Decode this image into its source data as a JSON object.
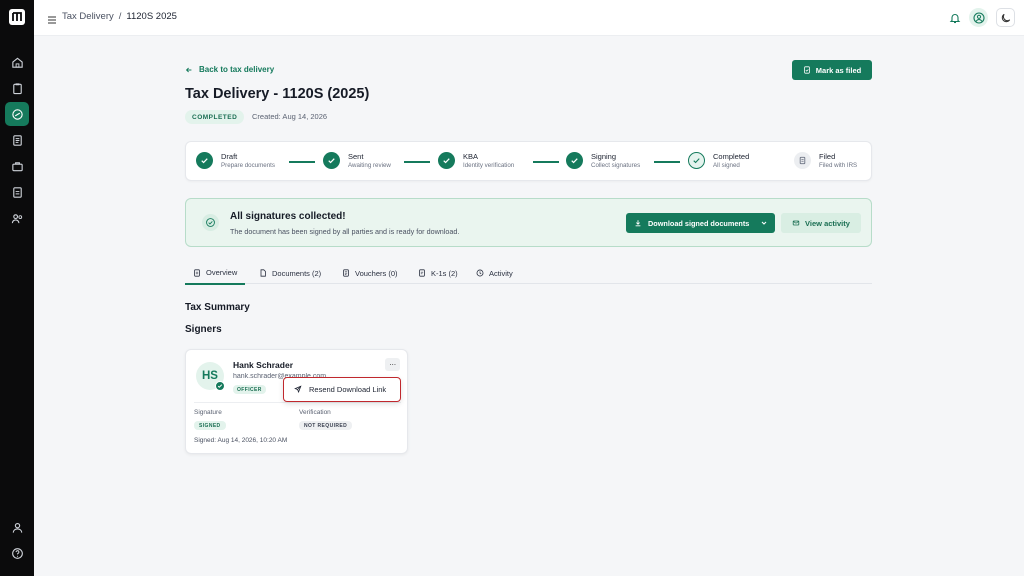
{
  "header": {
    "breadcrumb": [
      "Tax Delivery",
      "1120S 2025"
    ],
    "breadcrumb_sep": "/"
  },
  "page": {
    "back_link": "Back to tax delivery",
    "mark_filed_button": "Mark as filed",
    "title": "Tax Delivery - 1120S (2025)",
    "status_badge": "COMPLETED",
    "created": "Created: Aug 14, 2026"
  },
  "stepper": {
    "steps": [
      {
        "label": "Draft",
        "sub": "Prepare documents",
        "state": "done"
      },
      {
        "label": "Sent",
        "sub": "Awaiting review",
        "state": "done"
      },
      {
        "label": "KBA",
        "sub": "Identity verification",
        "state": "done"
      },
      {
        "label": "Signing",
        "sub": "Collect signatures",
        "state": "done"
      },
      {
        "label": "Completed",
        "sub": "All signed",
        "state": "current"
      },
      {
        "label": "Filed",
        "sub": "Filed with IRS",
        "state": "pending"
      }
    ]
  },
  "banner": {
    "title": "All signatures collected!",
    "subtitle": "The document has been signed by all parties and is ready for download.",
    "download_button": "Download signed documents",
    "activity_button": "View activity"
  },
  "tabs": [
    {
      "label": "Overview",
      "icon": "document-icon",
      "active": true
    },
    {
      "label": "Documents (2)",
      "icon": "file-icon",
      "active": false
    },
    {
      "label": "Vouchers (0)",
      "icon": "receipt-icon",
      "active": false
    },
    {
      "label": "K-1s (2)",
      "icon": "form-icon",
      "active": false
    },
    {
      "label": "Activity",
      "icon": "clock-icon",
      "active": false
    }
  ],
  "sections": {
    "tax_summary": "Tax Summary",
    "signers": "Signers"
  },
  "signer": {
    "initials": "HS",
    "name": "Hank Schrader",
    "email": "hank.schrader@example.com",
    "role": "OFFICER",
    "more": "···",
    "signature_label": "Signature",
    "signature_status": "SIGNED",
    "verification_label": "Verification",
    "verification_status": "NOT REQUIRED",
    "signed_at": "Signed: Aug 14, 2026, 10:20 AM"
  },
  "popup_menu": {
    "items": [
      {
        "label": "Resend Download Link",
        "icon": "send-icon"
      }
    ]
  },
  "colors": {
    "accent": "#157a5c",
    "sidebar": "#0b0b0c",
    "banner_bg": "#eaf5ef",
    "popup_highlight": "#c0282d"
  }
}
